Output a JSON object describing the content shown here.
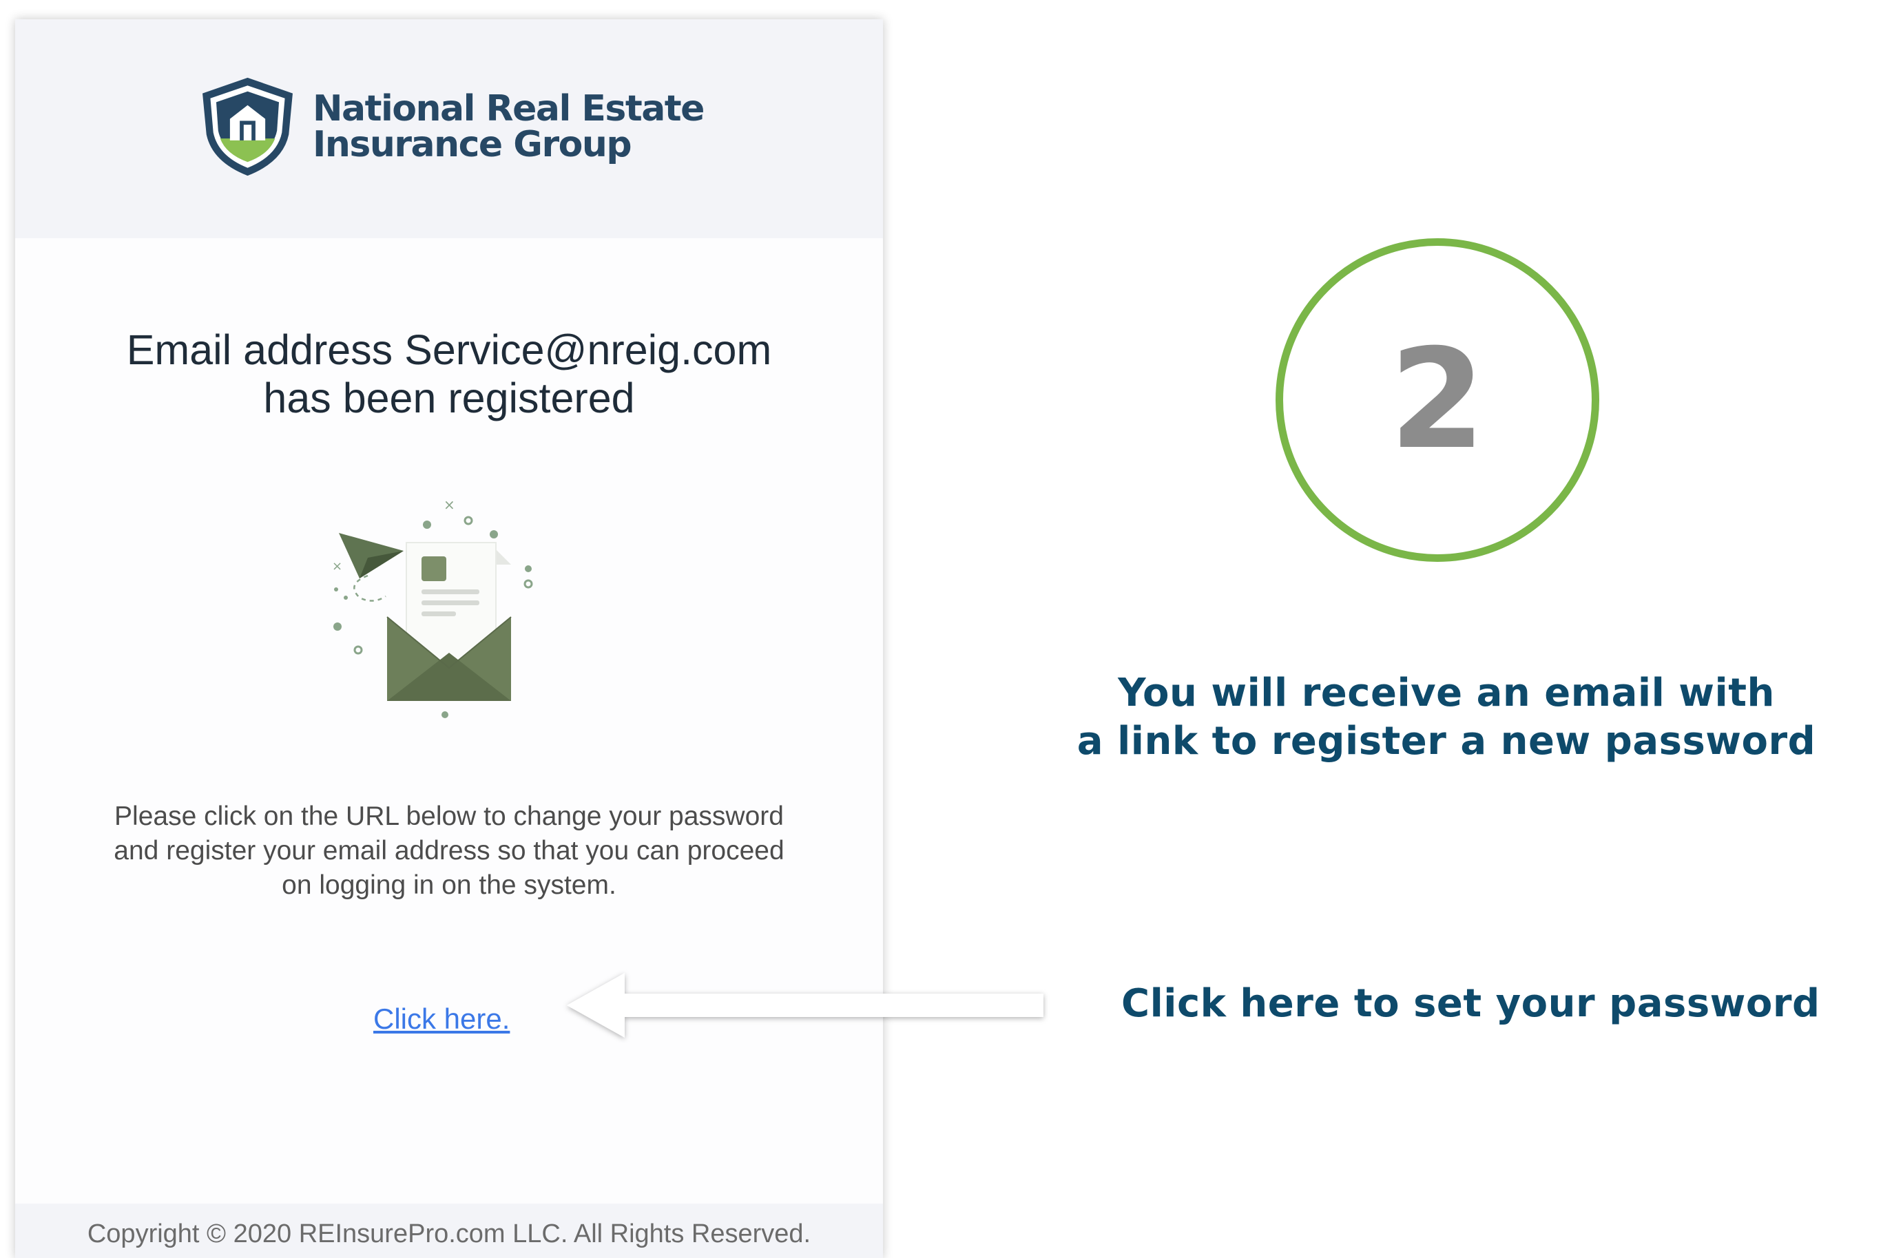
{
  "email": {
    "logo": {
      "line1": "National Real Estate",
      "line2": "Insurance Group",
      "icon": "shield-house-icon"
    },
    "title_line1": "Email address Service@nreig.com",
    "title_line2": "has been registered",
    "illustration": "envelope-paper-plane-illustration",
    "instructions_line1": "Please click on the URL below to change your password",
    "instructions_line2": "and register your email address so that you can proceed",
    "instructions_line3": "on logging in on the system.",
    "link_label": "Click here.",
    "copyright": "Copyright © 2020 REInsurePro.com LLC. All Rights Reserved."
  },
  "step": {
    "number": "2",
    "info_line1": "You will receive an email with",
    "info_line2": "a link to register a new password",
    "cta": "Click here to set your password",
    "arrow_icon": "left-arrow-icon"
  },
  "colors": {
    "brand_navy": "#274865",
    "accent_green": "#7ab648",
    "info_blue": "#0e4a6b",
    "link_blue": "#3b78e7",
    "illustration_green": "#6d7f5a"
  }
}
